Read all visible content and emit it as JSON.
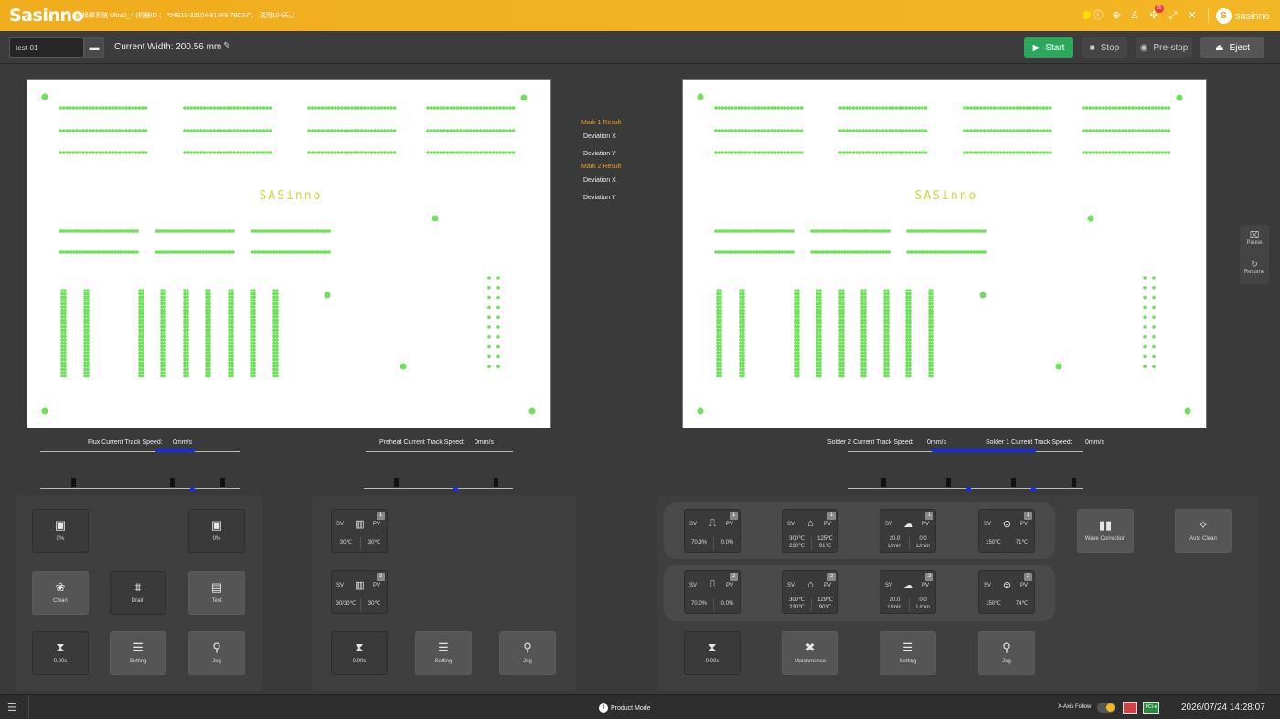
{
  "app": {
    "logo": "Sasinno",
    "title": "选择焊系统 Ultra2_4 (机器ID ： \"04E10-22104-814F9-78C37\"， 试用104天。)",
    "brand": "sasinno",
    "brand_initial": "S",
    "notification_count": "26"
  },
  "toolbar": {
    "recipe": "test-01",
    "current_width": "Current Width:  200.56 mm",
    "start": "Start",
    "stop": "Stop",
    "prestop": "Pre-stop",
    "eject": "Eject"
  },
  "board": {
    "label": "SASinno"
  },
  "marks": {
    "mark1": "Mark 1 Result",
    "mark2": "Mark 2 Result",
    "dev_x": "Deviation X",
    "dev_y": "Deviation Y"
  },
  "side": {
    "pause": "Pause",
    "resume": "Resume"
  },
  "speeds": {
    "flux_label": "Flux Current Track Speed:",
    "flux_value": "0mm/s",
    "preheat_label": "Preheat Current Track Speed:",
    "preheat_value": "0mm/s",
    "solder2_label": "Solder 2 Current Track Speed:",
    "solder2_value": "0mm/s",
    "solder1_label": "Solder 1 Current Track Speed:",
    "solder1_value": "0mm/s"
  },
  "flux": {
    "left_pct": "0%",
    "right_pct": "0%",
    "clean": "Clean",
    "drain": "Drain",
    "test": "Test",
    "timer": "0.00s",
    "setting": "Setting",
    "jog": "Jog"
  },
  "preheat": {
    "z1": {
      "num": "1",
      "sv": "SV",
      "pv": "PV",
      "sv_val": "30℃",
      "pv_val": "30℃"
    },
    "z2": {
      "num": "2",
      "sv": "SV",
      "pv": "PV",
      "sv_val": "30/30℃",
      "pv_val": "30℃"
    },
    "timer": "0.00s",
    "setting": "Setting",
    "jog": "Jog"
  },
  "solder": {
    "row1": {
      "num": "1",
      "wave": {
        "sv": "SV",
        "pv": "PV",
        "l": "70.3%",
        "r": "0.0%"
      },
      "pot": {
        "sv": "SV",
        "pv": "PV",
        "l1": "300℃",
        "l2": "230℃",
        "r1": "125℃",
        "r2": "91℃"
      },
      "n2": {
        "sv": "SV",
        "pv": "PV",
        "l1": "20.0",
        "l2": "L/min",
        "r1": "0.0",
        "r2": "L/min"
      },
      "nozzle": {
        "sv": "SV",
        "pv": "PV",
        "l": "150℃",
        "r": "71℃"
      }
    },
    "row2": {
      "num": "2",
      "wave": {
        "sv": "SV",
        "pv": "PV",
        "l": "70.0%",
        "r": "0.0%"
      },
      "pot": {
        "sv": "SV",
        "pv": "PV",
        "l1": "300℃",
        "l2": "230℃",
        "r1": "129℃",
        "r2": "90℃"
      },
      "n2": {
        "sv": "SV",
        "pv": "PV",
        "l1": "20.0",
        "l2": "L/min",
        "r1": "0.0",
        "r2": "L/min"
      },
      "nozzle": {
        "sv": "SV",
        "pv": "PV",
        "l": "150℃",
        "r": "74℃"
      }
    },
    "wave_correction": "Wave Correction",
    "auto_clean": "Auto Clean",
    "timer": "0.00s",
    "maintenance": "Maintenance",
    "setting": "Setting",
    "jog": "Jog"
  },
  "status": {
    "mode": "Product Mode",
    "x_follow": "X-Axis Follow",
    "pci": "PCI-e",
    "datetime": "2026/07/24 14:28:07"
  },
  "colors": {
    "accent": "#f0ad1e",
    "start": "#2aa85c",
    "pad": "#6ee05a",
    "speed_bar": "#1a2fd8",
    "mark_title": "#f0a020"
  }
}
